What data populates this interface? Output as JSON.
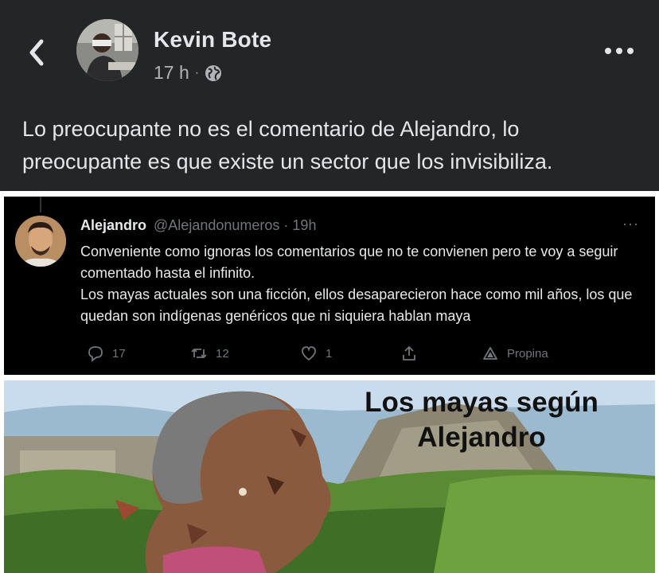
{
  "header": {
    "author_name": "Kevin Bote",
    "timestamp": "17 h",
    "separator": "·",
    "privacy_icon": "globe-icon",
    "back_icon": "chevron-left-icon",
    "more_icon": "ellipsis-icon"
  },
  "post": {
    "text": "Lo preocupante no es el comentario de Alejandro, lo preocupante es que existe un sector que los invisibiliza."
  },
  "tweet": {
    "name": "Alejandro",
    "handle": "@Alejandonumeros",
    "time": "· 19h",
    "more": "···",
    "paragraph1": "Conveniente como ignoras los comentarios que no te convienen pero te voy a seguir comentado hasta el infinito.",
    "paragraph2": "Los mayas actuales son una ficción, ellos desaparecieron hace como mil años, los que quedan son indígenas genéricos que ni siquiera hablan maya",
    "actions": {
      "replies": "17",
      "retweets": "12",
      "likes": "1",
      "tip_label": "Propina"
    }
  },
  "meme": {
    "caption_line1": "Los mayas según",
    "caption_line2": "Alejandro"
  },
  "colors": {
    "background": "#242526",
    "text_primary": "#e4e6eb",
    "text_secondary": "#b0b3b8",
    "tweet_background": "#000000"
  }
}
